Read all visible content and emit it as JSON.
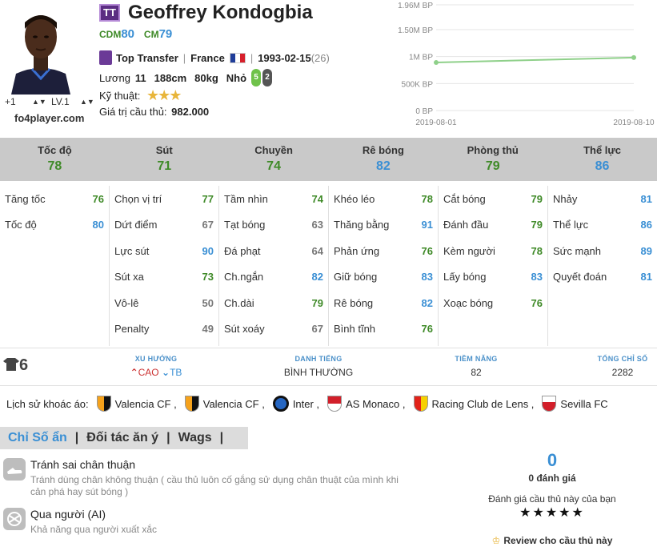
{
  "player": {
    "badge": "TT",
    "name": "Geoffrey Kondogbia",
    "positions": [
      {
        "tag": "CDM",
        "value": "80"
      },
      {
        "tag": "CM",
        "value": "79"
      }
    ],
    "season": "Top Transfer",
    "nationality": "France",
    "birth_date": "1993-02-15",
    "age": "(26)",
    "salary_label": "Lương",
    "salary": "11",
    "height": "188cm",
    "weight": "80kg",
    "build": "Nhỏ",
    "foot_left": "5",
    "foot_right": "2",
    "skill_label": "Kỹ thuật:",
    "skill_stars": "★★★",
    "value_label": "Giá trị cầu thủ:",
    "value": "982.000",
    "upgrade": "+1",
    "level": "LV.1",
    "site": "fo4player.com"
  },
  "price_chart": {
    "type": "line",
    "yticks": [
      "1.96M BP",
      "1.50M BP",
      "1M BP",
      "500K BP",
      "0 BP"
    ],
    "ytick_values": [
      1960000,
      1500000,
      1000000,
      500000,
      0
    ],
    "ylim": [
      0,
      1960000
    ],
    "x": [
      "2019-08-01",
      "2019-08-10"
    ],
    "values": [
      890000,
      982000
    ],
    "line_color": "#8fd08a",
    "grid": true
  },
  "groups": [
    {
      "name": "Tốc độ",
      "value": "78",
      "color": "#3f8a28"
    },
    {
      "name": "Sút",
      "value": "71",
      "color": "#3f8a28"
    },
    {
      "name": "Chuyền",
      "value": "74",
      "color": "#3f8a28"
    },
    {
      "name": "Rê bóng",
      "value": "82",
      "color": "#3a8fd4"
    },
    {
      "name": "Phòng thủ",
      "value": "79",
      "color": "#3f8a28"
    },
    {
      "name": "Thể lực",
      "value": "86",
      "color": "#3a8fd4"
    }
  ],
  "stat_columns": [
    [
      {
        "name": "Tăng tốc",
        "value": "76",
        "color": "#3f8a28"
      },
      {
        "name": "Tốc độ",
        "value": "80",
        "color": "#3a8fd4"
      }
    ],
    [
      {
        "name": "Chọn vị trí",
        "value": "77",
        "color": "#3f8a28"
      },
      {
        "name": "Dứt điểm",
        "value": "67",
        "color": "#777777"
      },
      {
        "name": "Lực sút",
        "value": "90",
        "color": "#3a8fd4"
      },
      {
        "name": "Sút xa",
        "value": "73",
        "color": "#3f8a28"
      },
      {
        "name": "Vô-lê",
        "value": "50",
        "color": "#777777"
      },
      {
        "name": "Penalty",
        "value": "49",
        "color": "#777777"
      }
    ],
    [
      {
        "name": "Tầm nhìn",
        "value": "74",
        "color": "#3f8a28"
      },
      {
        "name": "Tạt bóng",
        "value": "63",
        "color": "#777777"
      },
      {
        "name": "Đá phạt",
        "value": "64",
        "color": "#777777"
      },
      {
        "name": "Ch.ngắn",
        "value": "82",
        "color": "#3a8fd4"
      },
      {
        "name": "Ch.dài",
        "value": "79",
        "color": "#3f8a28"
      },
      {
        "name": "Sút xoáy",
        "value": "67",
        "color": "#777777"
      }
    ],
    [
      {
        "name": "Khéo léo",
        "value": "78",
        "color": "#3f8a28"
      },
      {
        "name": "Thăng bằng",
        "value": "91",
        "color": "#3a8fd4"
      },
      {
        "name": "Phản ứng",
        "value": "76",
        "color": "#3f8a28"
      },
      {
        "name": "Giữ bóng",
        "value": "83",
        "color": "#3a8fd4"
      },
      {
        "name": "Rê bóng",
        "value": "82",
        "color": "#3a8fd4"
      },
      {
        "name": "Bình tĩnh",
        "value": "76",
        "color": "#3f8a28"
      }
    ],
    [
      {
        "name": "Cắt bóng",
        "value": "79",
        "color": "#3f8a28"
      },
      {
        "name": "Đánh đầu",
        "value": "79",
        "color": "#3f8a28"
      },
      {
        "name": "Kèm người",
        "value": "78",
        "color": "#3f8a28"
      },
      {
        "name": "Lấy bóng",
        "value": "83",
        "color": "#3a8fd4"
      },
      {
        "name": "Xoạc bóng",
        "value": "76",
        "color": "#3f8a28"
      }
    ],
    [
      {
        "name": "Nhảy",
        "value": "81",
        "color": "#3a8fd4"
      },
      {
        "name": "Thể lực",
        "value": "86",
        "color": "#3a8fd4"
      },
      {
        "name": "Sức mạnh",
        "value": "89",
        "color": "#3a8fd4"
      },
      {
        "name": "Quyết đoán",
        "value": "81",
        "color": "#3a8fd4"
      }
    ]
  ],
  "strip": {
    "shirt_number": "6",
    "trend_title": "XU HƯỚNG",
    "trend_up": "CAO",
    "trend_down": "TB",
    "reputation_title": "DANH TIẾNG",
    "reputation": "BÌNH THƯỜNG",
    "potential_title": "TIỀM NĂNG",
    "potential": "82",
    "total_title": "TỔNG CHỈ SỐ",
    "total": "2282"
  },
  "clubs": {
    "label": "Lịch sử khoác áo:",
    "items": [
      {
        "name": "Valencia CF ,",
        "crest": "valencia"
      },
      {
        "name": "Valencia CF ,",
        "crest": "valencia"
      },
      {
        "name": "Inter ,",
        "crest": "inter"
      },
      {
        "name": "AS Monaco ,",
        "crest": "monaco"
      },
      {
        "name": "Racing Club de Lens ,",
        "crest": "lens"
      },
      {
        "name": "Sevilla FC",
        "crest": "sevilla"
      }
    ]
  },
  "tabs": [
    "Chỉ Số ẩn",
    "Đối tác ăn ý",
    "Wags"
  ],
  "traits": [
    {
      "title": "Tránh sai chân thuận",
      "desc": "Tránh dùng chân không thuận ( cầu thủ luôn cố gắng sử dụng chân thuật của mình khi cản phá hay sút bóng )",
      "icon": "boot-icon"
    },
    {
      "title": "Qua người (AI)",
      "desc": "Khả năng qua người xuất xắc",
      "icon": "dribble-icon"
    }
  ],
  "rating": {
    "score": "0",
    "count": "0 đánh giá",
    "prompt": "Đánh giá cầu thủ này của bạn",
    "stars": "★★★★★",
    "review_label": "Review cho cầu thủ này"
  }
}
